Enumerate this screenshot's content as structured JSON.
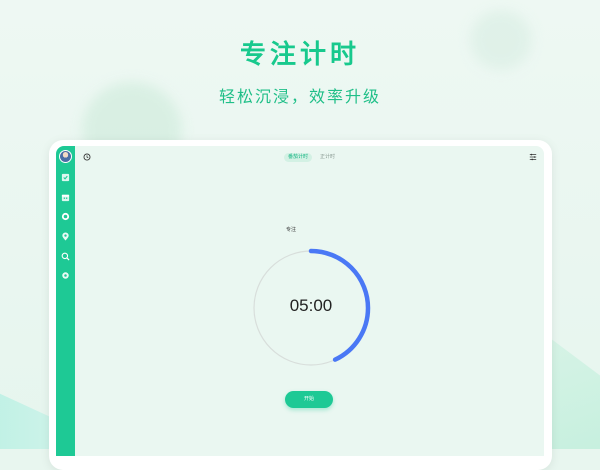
{
  "hero": {
    "title": "专注计时",
    "subtitle": "轻松沉浸，效率升级"
  },
  "colors": {
    "accent": "#1ec995",
    "ring": "#4a78f5",
    "ring_track": "#d8dedb"
  },
  "topbar": {
    "left_icon": "history-icon",
    "right_icon": "settings-list-icon",
    "tabs": [
      {
        "label": "番茄计时",
        "active": true
      },
      {
        "label": "正计时",
        "active": false
      }
    ]
  },
  "sidebar": {
    "avatar": "user-avatar",
    "items": [
      {
        "icon": "checkbox-icon"
      },
      {
        "icon": "calendar-icon"
      },
      {
        "icon": "target-icon"
      },
      {
        "icon": "location-pin-icon"
      },
      {
        "icon": "search-icon"
      },
      {
        "icon": "settings-icon"
      }
    ]
  },
  "timer": {
    "label": "专注",
    "time": "05:00",
    "progress": 0.43,
    "start_label": "开始"
  }
}
